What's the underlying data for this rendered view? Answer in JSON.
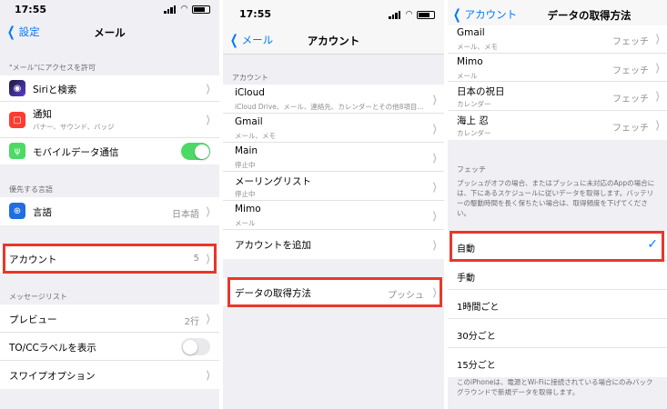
{
  "colors": {
    "accent": "#007aff",
    "highlight": "#e8372a",
    "toggle_on": "#4cd964",
    "toggle_off": "#e9e9eb"
  },
  "panel1": {
    "status": {
      "time": "17:55"
    },
    "nav": {
      "back": "設定",
      "title": "メール"
    },
    "section_access": "\"メール\"にアクセスを許可",
    "access_rows": [
      {
        "label": "Siriと検索",
        "icon": "siri-icon"
      },
      {
        "label": "通知",
        "sub": "バナー、サウンド、バッジ",
        "icon": "notification-icon"
      },
      {
        "label": "モバイルデータ通信",
        "icon": "cellular-antenna-icon",
        "toggle": true
      }
    ],
    "section_language": "優先する言語",
    "language": {
      "label": "言語",
      "value": "日本語",
      "icon": "globe-icon"
    },
    "accounts": {
      "label": "アカウント",
      "value": "5"
    },
    "section_message": "メッセージリスト",
    "message_rows": [
      {
        "label": "プレビュー",
        "value": "2行"
      },
      {
        "label": "TO/CCラベルを表示",
        "toggle": false
      },
      {
        "label": "スワイプオプション"
      }
    ]
  },
  "panel2": {
    "status": {
      "time": "17:55"
    },
    "nav": {
      "back": "メール",
      "title": "アカウント"
    },
    "section_accounts": "アカウント",
    "accounts": [
      {
        "label": "iCloud",
        "sub": "iCloud Drive、メール、連絡先、カレンダーとその他8項目..."
      },
      {
        "label": "Gmail",
        "sub": "メール、メモ"
      },
      {
        "label": "Main",
        "sub": "停止中"
      },
      {
        "label": "メーリングリスト",
        "sub": "停止中"
      },
      {
        "label": "Mimo",
        "sub": "メール"
      },
      {
        "label": "アカウントを追加"
      }
    ],
    "fetch": {
      "label": "データの取得方法",
      "value": "プッシュ"
    }
  },
  "panel3": {
    "nav": {
      "back": "アカウント",
      "title": "データの取得方法"
    },
    "accounts": [
      {
        "label": "Gmail",
        "sub": "メール、メモ",
        "value": "フェッチ"
      },
      {
        "label": "Mimo",
        "sub": "メール",
        "value": "フェッチ"
      },
      {
        "label": "日本の祝日",
        "sub": "カレンダー",
        "value": "フェッチ"
      },
      {
        "label": "海上 忍",
        "sub": "カレンダー",
        "value": "フェッチ"
      }
    ],
    "section_fetch": "フェッチ",
    "fetch_description": "プッシュがオフの場合、またはプッシュに未対応のAppの場合には、下にあるスケジュールに従いデータを取得します。バッテリーの駆動時間を長く保ちたい場合は、取得頻度を下げてください。",
    "options": [
      {
        "label": "自動",
        "selected": true
      },
      {
        "label": "手動"
      },
      {
        "label": "1時間ごと"
      },
      {
        "label": "30分ごと"
      },
      {
        "label": "15分ごと"
      }
    ],
    "footer_note": "このiPhoneは、電源とWi-Fiに接続されている場合にのみバックグラウンドで新規データを取得します。"
  }
}
